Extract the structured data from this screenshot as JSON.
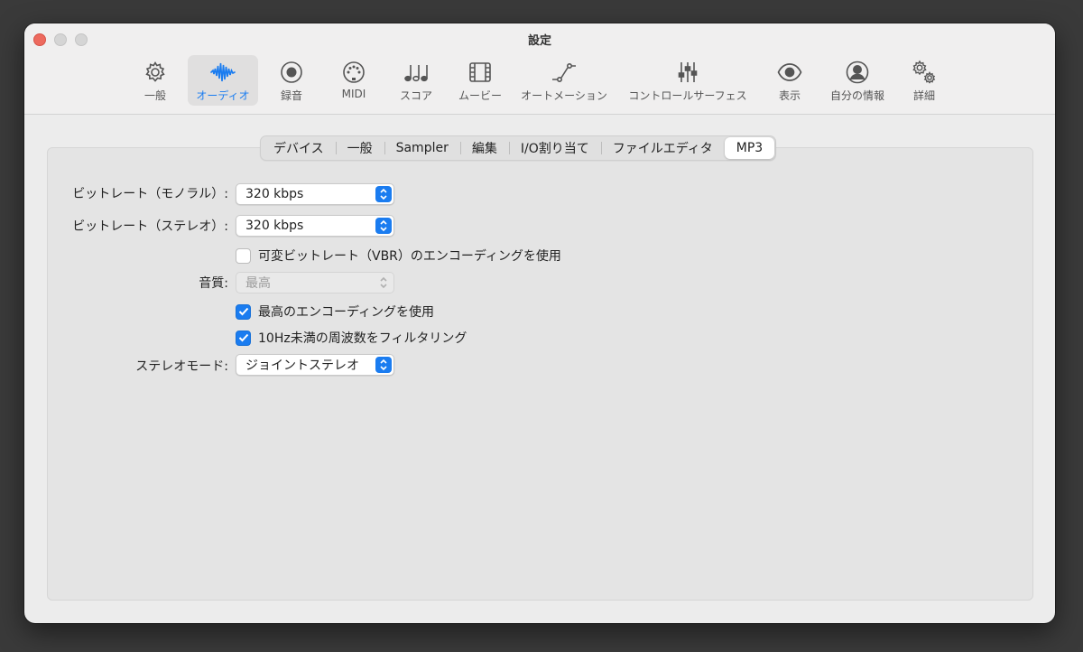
{
  "window": {
    "title": "設定"
  },
  "toolbar": [
    {
      "label": "一般",
      "icon": "gear-icon"
    },
    {
      "label": "オーディオ",
      "icon": "waveform-icon",
      "active": true
    },
    {
      "label": "録音",
      "icon": "record-icon"
    },
    {
      "label": "MIDI",
      "icon": "midi-port-icon"
    },
    {
      "label": "スコア",
      "icon": "music-notes-icon"
    },
    {
      "label": "ムービー",
      "icon": "film-icon"
    },
    {
      "label": "オートメーション",
      "icon": "automation-curve-icon"
    },
    {
      "label": "コントロールサーフェス",
      "icon": "sliders-icon"
    },
    {
      "label": "表示",
      "icon": "eye-icon"
    },
    {
      "label": "自分の情報",
      "icon": "person-icon"
    },
    {
      "label": "詳細",
      "icon": "gears-icon"
    }
  ],
  "tabs": [
    {
      "label": "デバイス"
    },
    {
      "label": "一般"
    },
    {
      "label": "Sampler"
    },
    {
      "label": "編集"
    },
    {
      "label": "I/O割り当て"
    },
    {
      "label": "ファイルエディタ"
    },
    {
      "label": "MP3",
      "selected": true
    }
  ],
  "form": {
    "bitrate_mono": {
      "label": "ビットレート（モノラル）:",
      "value": "320 kbps"
    },
    "bitrate_stereo": {
      "label": "ビットレート（ステレオ）:",
      "value": "320 kbps"
    },
    "vbr": {
      "label": "可変ビットレート（VBR）のエンコーディングを使用",
      "checked": false
    },
    "quality": {
      "label": "音質:",
      "value": "最高",
      "disabled": true
    },
    "best_encoding": {
      "label": "最高のエンコーディングを使用",
      "checked": true
    },
    "filter_10hz": {
      "label": "10Hz未満の周波数をフィルタリング",
      "checked": true
    },
    "stereo_mode": {
      "label": "ステレオモード:",
      "value": "ジョイントステレオ"
    }
  },
  "colors": {
    "accent": "#1a7cf0",
    "close": "#ed6a5e"
  }
}
